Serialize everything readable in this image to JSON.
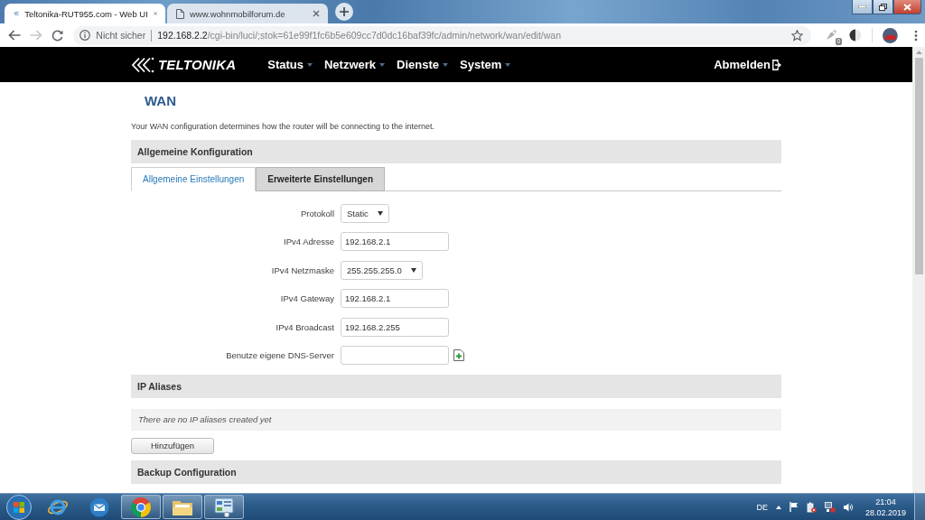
{
  "browser": {
    "tabs": [
      {
        "kind": "logo",
        "title": "Teltonika-RUT955.com - Web UI",
        "selected": true
      },
      {
        "kind": "page",
        "title": "www.wohnmobilforum.de",
        "selected": false
      }
    ],
    "nav_buttons": [
      {
        "kind": "back",
        "disabled": false
      },
      {
        "kind": "forward",
        "disabled": true
      },
      {
        "kind": "reload",
        "disabled": false
      }
    ],
    "security_label": "Nicht sicher",
    "url": "192.168.2.2/cgi-bin/luci/;stok=61e99f1fc6b5e609cc7d0dc16baf39fc/admin/network/wan/edit/wan",
    "extension_badge": "0"
  },
  "navbar": {
    "logo": "TELTONIKA",
    "menu": [
      "Status",
      "Netzwerk",
      "Dienste",
      "System"
    ],
    "logout": "Abmelden"
  },
  "page": {
    "title": "WAN",
    "description": "Your WAN configuration determines how the router will be connecting to the internet."
  },
  "general": {
    "header": "Allgemeine Konfiguration",
    "tabs": [
      {
        "label": "Allgemeine Einstellungen",
        "selected": true
      },
      {
        "label": "Erweiterte Einstellungen",
        "selected": false
      }
    ],
    "fields": [
      {
        "kind": "select",
        "label": "Protokoll",
        "value": "Static"
      },
      {
        "kind": "input",
        "label": "IPv4 Adresse",
        "value": "192.168.2.1"
      },
      {
        "kind": "select",
        "label": "IPv4 Netzmaske",
        "value": "255.255.255.0"
      },
      {
        "kind": "input",
        "label": "IPv4 Gateway",
        "value": "192.168.2.1"
      },
      {
        "kind": "input",
        "label": "IPv4 Broadcast",
        "value": "192.168.2.255"
      },
      {
        "kind": "dynlist",
        "label": "Benutze eigene DNS-Server"
      }
    ]
  },
  "ip_aliases": {
    "header": "IP Aliases",
    "empty_message": "There are no IP aliases created yet",
    "add_button": "Hinzufügen"
  },
  "backup": {
    "header": "Backup Configuration"
  },
  "taskbar": {
    "apps": [
      {
        "kind": "globe",
        "running": false
      },
      {
        "kind": "mail",
        "running": false
      },
      {
        "kind": "orb",
        "running": true
      },
      {
        "kind": "folder",
        "running": true
      },
      {
        "kind": "panel",
        "running": true
      }
    ],
    "language": "DE",
    "time": "21:04",
    "date": "28.02.2019"
  }
}
